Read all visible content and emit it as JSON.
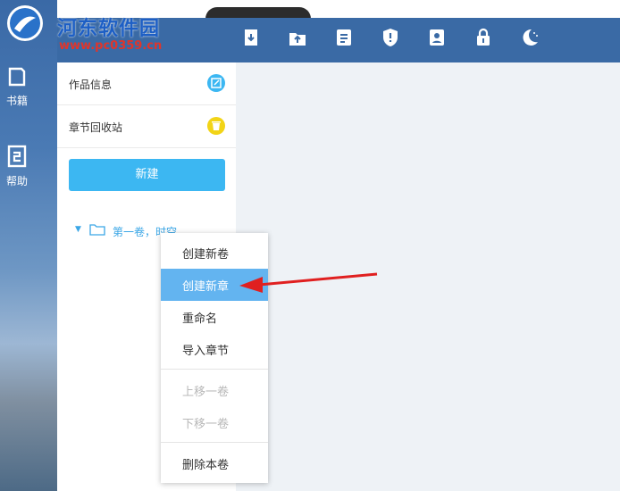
{
  "watermark": {
    "title": "河东软件园",
    "url": "www.pc0359.cn"
  },
  "sidebar": {
    "items": [
      {
        "label": "书籍",
        "icon": "book-icon"
      },
      {
        "label": "帮助",
        "icon": "help-icon"
      }
    ]
  },
  "toolbar": {
    "icons": [
      "import-icon",
      "upload-icon",
      "list-icon",
      "shield-icon",
      "contact-icon",
      "lock-icon",
      "night-mode-icon"
    ]
  },
  "panel": {
    "rows": [
      {
        "label": "作品信息",
        "icon": "edit-icon",
        "color": "#3cb7f2"
      },
      {
        "label": "章节回收站",
        "icon": "trash-icon",
        "color": "#f2d417"
      }
    ],
    "new_button": "新建",
    "tree_item": "第一卷，时空"
  },
  "context_menu": {
    "items": [
      {
        "label": "创建新卷",
        "state": "normal"
      },
      {
        "label": "创建新章",
        "state": "active"
      },
      {
        "label": "重命名",
        "state": "normal"
      },
      {
        "label": "导入章节",
        "state": "normal"
      },
      {
        "label": "上移一卷",
        "state": "disabled"
      },
      {
        "label": "下移一卷",
        "state": "disabled"
      },
      {
        "label": "删除本卷",
        "state": "normal"
      }
    ]
  },
  "annotation_color": "#e02020"
}
